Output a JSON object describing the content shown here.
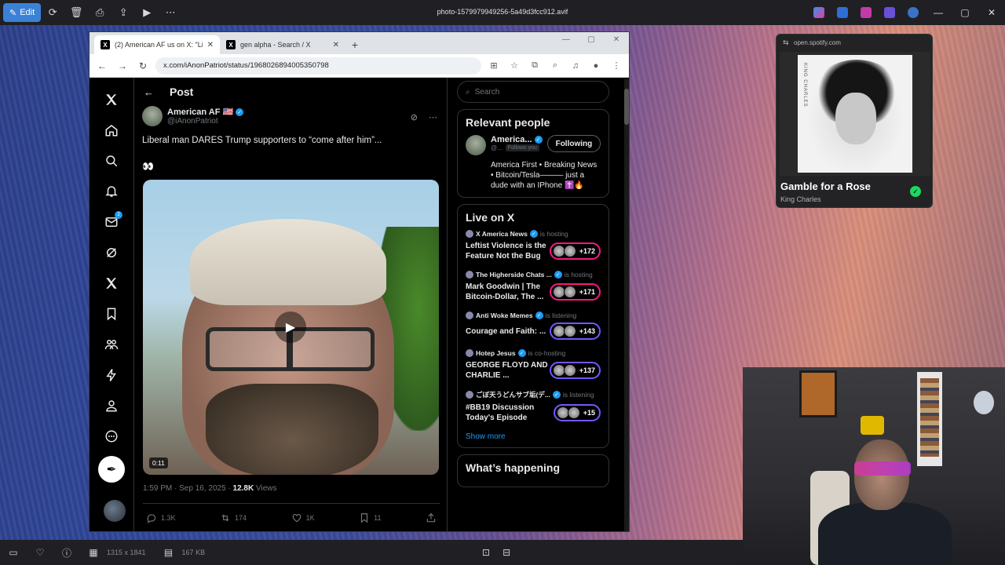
{
  "viewer": {
    "edit_label": "Edit",
    "filename": "photo-1579979949256-5a49d3fcc912.avif",
    "dimensions": "1315 x 1841",
    "filesize": "167 KB"
  },
  "browser": {
    "tabs": [
      {
        "title": "(2) American AF us on X: \"Liber",
        "active": true
      },
      {
        "title": "gen alpha - Search / X",
        "active": false
      }
    ],
    "url": "x.com/iAnonPatriot/status/1968026894005350798"
  },
  "x": {
    "nav_badge": "2",
    "page_title": "Post",
    "post": {
      "author_name": "American AF 🇺🇸",
      "author_handle": "@iAnonPatriot",
      "text": "Liberal man DARES Trump supporters to “come after him”...",
      "emoji": "👀",
      "video_duration": "0:11",
      "time": "1:59 PM · Sep 16, 2025 · ",
      "views_count": "12.8K",
      "views_label": " Views",
      "replies": "1.3K",
      "reposts": "174",
      "likes": "1K",
      "bookmarks": "11"
    },
    "sidebar": {
      "search_placeholder": "Search",
      "relevant_title": "Relevant people",
      "person": {
        "name": "America...",
        "handle": "@...",
        "follows_you": "Follows you",
        "follow_label": "Following",
        "bio": "America First • Breaking News • Bitcoin/Tesla——— just a dude with an IPhone ✝️🔥"
      },
      "live_title": "Live on X",
      "spaces": [
        {
          "host": "X America News",
          "role": "is hosting",
          "title": "Leftist Violence is the Feature Not the Bug",
          "count": "+172",
          "ring": "pink"
        },
        {
          "host": "The Higherside Chats ...",
          "role": "is hosting",
          "title": "Mark Goodwin | The Bitcoin-Dollar, The ...",
          "count": "+171",
          "ring": "pink"
        },
        {
          "host": "Anti Woke Memes",
          "role": "is listening",
          "title": "Courage and Faith: ...",
          "count": "+143",
          "ring": "purple"
        },
        {
          "host": "Hotep Jesus",
          "role": "is co-hosting",
          "title": "GEORGE FLOYD AND CHARLIE ...",
          "count": "+137",
          "ring": "purple"
        },
        {
          "host": "ごぼ天うどんサブ垢(デ...",
          "role": "is listening",
          "title": "#BB19 Discussion Today's Episode",
          "count": "+15",
          "ring": "purple"
        }
      ],
      "show_more": "Show more",
      "happening_title": "What’s happening"
    }
  },
  "spotify": {
    "url": "open.spotify.com",
    "track": "Gamble for a Rose",
    "artist": "King Charles",
    "cover_text": "KING CHARLES"
  },
  "colors": {
    "accent": "#1d9bf0",
    "edit": "#3b82d6",
    "spotify_green": "#1ed760",
    "space_pink": "#f91880",
    "space_purple": "#7856ff"
  }
}
